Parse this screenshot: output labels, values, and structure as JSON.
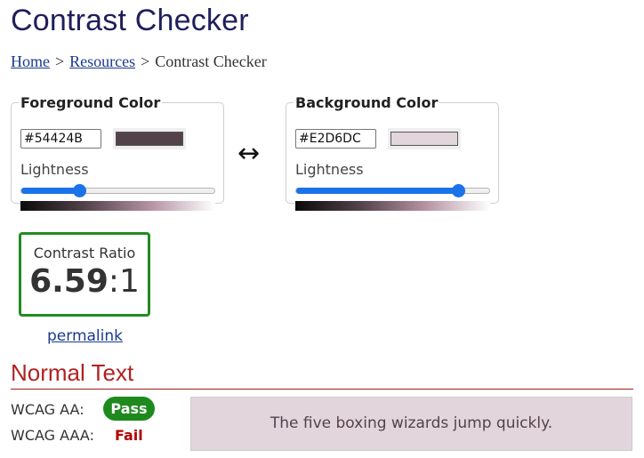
{
  "page": {
    "title": "Contrast Checker"
  },
  "breadcrumb": {
    "home": "Home",
    "resources": "Resources",
    "current": "Contrast Checker",
    "separator": ">"
  },
  "foreground": {
    "legend": "Foreground Color",
    "hex": "#54424B",
    "swatch_color": "#54424B",
    "lightness_label": "Lightness",
    "lightness_fraction": 0.3,
    "gradient": [
      "#0a0a0a",
      "#54424B",
      "#b592a3",
      "#ffffff"
    ]
  },
  "background": {
    "legend": "Background Color",
    "hex": "#E2D6DC",
    "swatch_color": "#E2D6DC",
    "lightness_label": "Lightness",
    "lightness_fraction": 0.84,
    "gradient": [
      "#0a0a0a",
      "#54424B",
      "#b592a3",
      "#ffffff"
    ]
  },
  "swap": {
    "icon": "left-right-arrow-icon",
    "glyph": "↔"
  },
  "contrast": {
    "label": "Contrast Ratio",
    "value": "6.59",
    "suffix": ":1",
    "border_color": "#228b22"
  },
  "permalink": {
    "label": "permalink"
  },
  "normal_text": {
    "title": "Normal Text",
    "aa_label": "WCAG AA:",
    "aa_result": "Pass",
    "aaa_label": "WCAG AAA:",
    "aaa_result": "Fail",
    "sample": "The five boxing wizards jump quickly.",
    "sample_fg": "#54424B",
    "sample_bg": "#E2D6DC",
    "pass_color": "#1e8a1e",
    "fail_color": "#b00000"
  }
}
